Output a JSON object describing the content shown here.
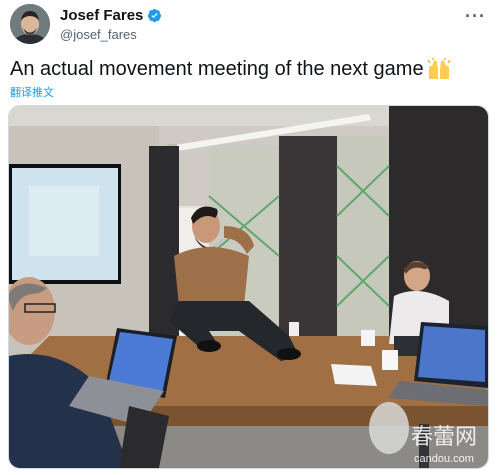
{
  "tweet": {
    "display_name": "Josef Fares",
    "handle": "@josef_fares",
    "text": "An actual movement meeting of the next game",
    "translate_label": "翻译推文",
    "more_icon": "more-horizontal-icon",
    "verified_icon": "verified-badge-icon",
    "emoji": "raising-hands-emoji"
  },
  "media": {
    "description_icon": "photo",
    "watermark_text": "春蕾网",
    "watermark_domain": "candou.com"
  },
  "colors": {
    "accent": "#1d9bf0",
    "text_primary": "#0f1419",
    "text_secondary": "#536471"
  }
}
